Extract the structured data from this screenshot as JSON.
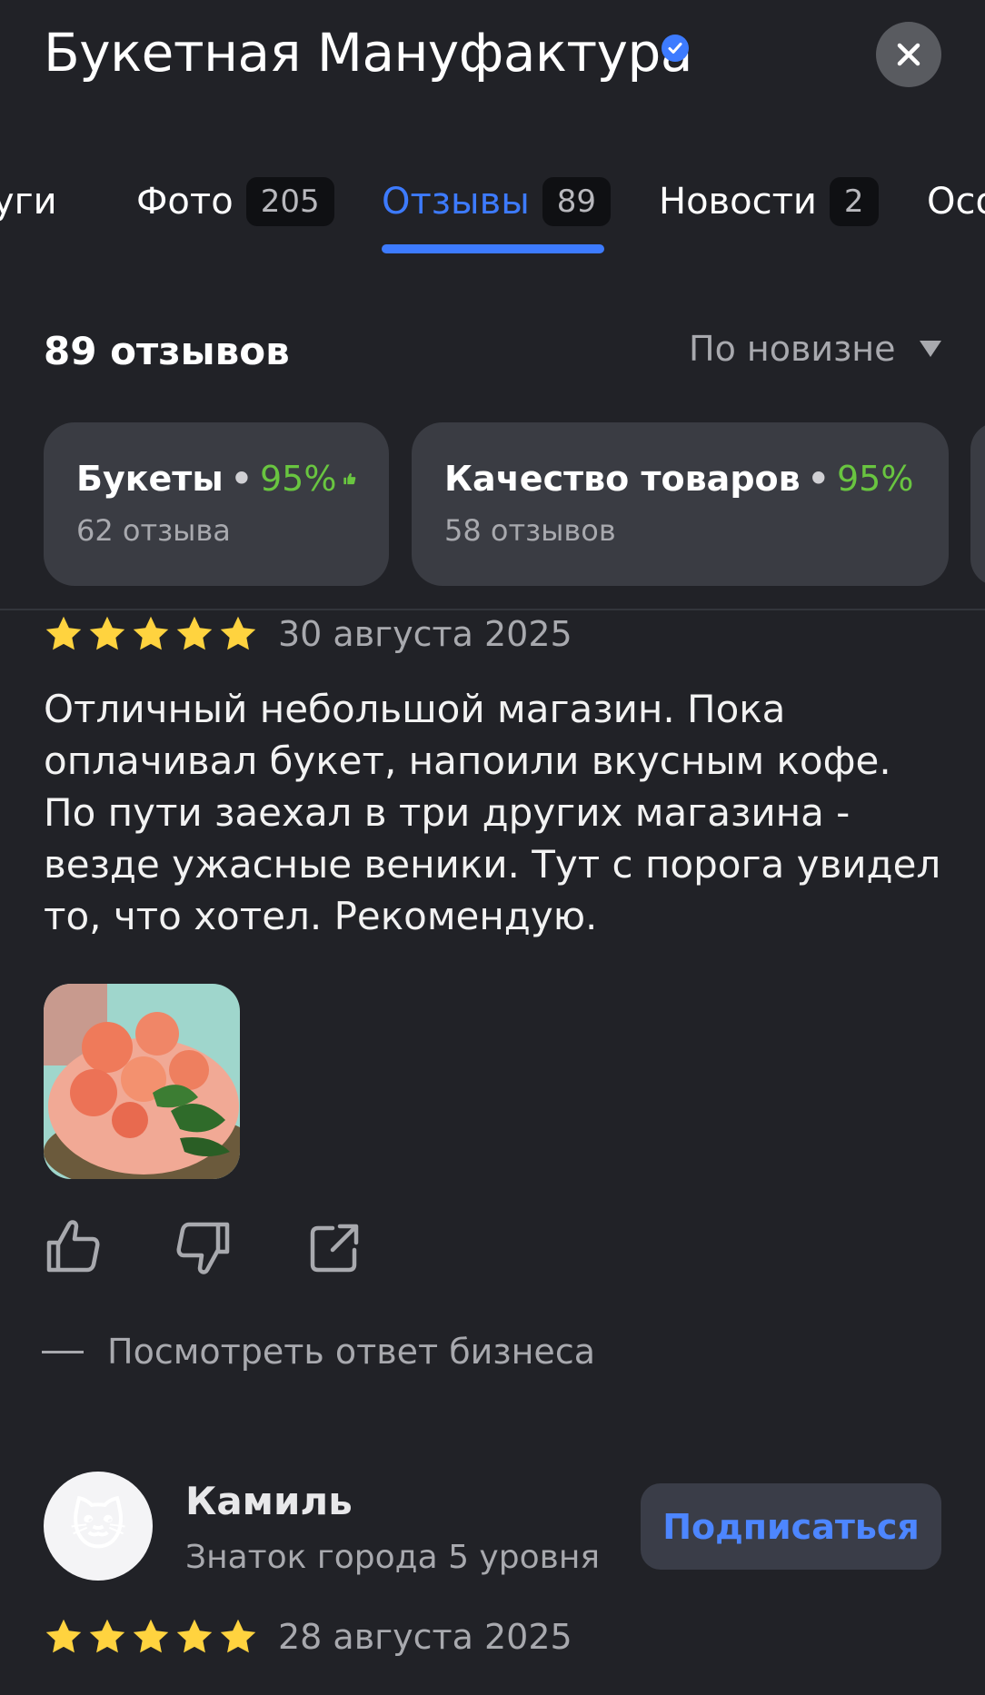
{
  "header": {
    "title": "Букетная Мануфактура"
  },
  "tabs": [
    {
      "label": "Услуги",
      "count": null
    },
    {
      "label": "Фото",
      "count": "205"
    },
    {
      "label": "Отзывы",
      "count": "89",
      "active": true
    },
    {
      "label": "Новости",
      "count": "2"
    },
    {
      "label": "Особенности",
      "count": null
    }
  ],
  "reviews_header": {
    "count_label": "89 отзывов",
    "sort_label": "По новизне"
  },
  "categories": [
    {
      "name": "Букеты",
      "percent": "95%",
      "reviews": "62 отзыва"
    },
    {
      "name": "Качество товаров",
      "percent": "95%",
      "reviews": "58 отзывов"
    }
  ],
  "review1": {
    "rating": 5,
    "date": "30 августа 2025",
    "text": "Отличный небольшой магазин. Пока оплачивал букет, напоили вкусным кофе. По пути заехал в три других магазина - везде ужасные веники. Тут с порога увидел то, что хотел. Рекомендую.",
    "business_reply_label": "Посмотреть ответ бизнеса"
  },
  "review2": {
    "author": "Камиль",
    "level": "Знаток города 5 уровня",
    "subscribe_label": "Подписаться",
    "rating": 5,
    "date": "28 августа 2025",
    "avatar_emoji": "🐱"
  },
  "colors": {
    "background": "#212227",
    "accent": "#3d7bff",
    "positive": "#69c540",
    "star": "#ffd33f",
    "card": "#3a3c43"
  },
  "icons": [
    "verified-icon",
    "close-icon",
    "sort-arrow-icon",
    "thumbs-up-icon",
    "star-icon",
    "like-icon",
    "dislike-icon",
    "share-icon"
  ]
}
